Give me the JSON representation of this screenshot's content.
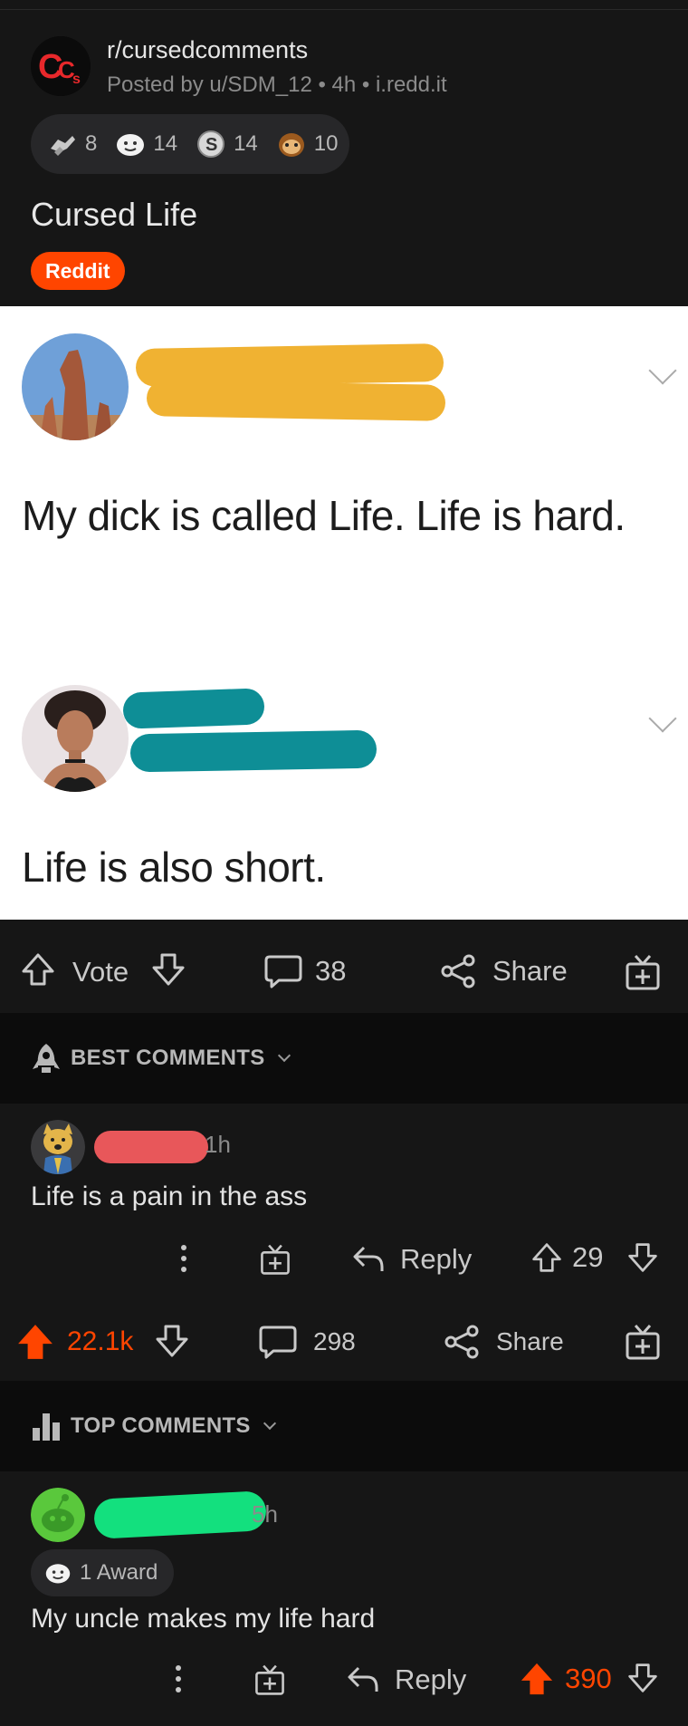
{
  "post": {
    "subreddit": "r/cursedcomments",
    "meta": "Posted by u/SDM_12 • 4h • i.redd.it",
    "awards": [
      {
        "icon": "handshake-award-icon",
        "count": "8"
      },
      {
        "icon": "wholesome-award-icon",
        "count": "14"
      },
      {
        "icon": "silver-award-icon",
        "count": "14"
      },
      {
        "icon": "sloth-award-icon",
        "count": "10"
      }
    ],
    "title": "Cursed Life",
    "flair": "Reddit",
    "image": {
      "tweet1_text": "My dick is called Life. Life is hard.",
      "tweet2_text": "Life is also short."
    },
    "actions": {
      "vote_label": "Vote",
      "comments_count": "38",
      "share_label": "Share"
    }
  },
  "best_comments": {
    "header": "BEST COMMENTS",
    "comment": {
      "time": "1h",
      "text": "Life is a pain in the ass",
      "reply_label": "Reply",
      "score": "29"
    }
  },
  "stats_bar": {
    "score": "22.1k",
    "comments_count": "298",
    "share_label": "Share"
  },
  "top_comments": {
    "header": "TOP COMMENTS",
    "comment": {
      "time": "5h",
      "award_label": "1 Award",
      "text": "My uncle makes my life hard",
      "reply_label": "Reply",
      "score": "390"
    }
  },
  "colors": {
    "background": "#161616",
    "accent": "#ff4500",
    "yellow_scribble": "#f0b232",
    "teal_scribble": "#0e8e96",
    "red_scribble": "#e8575a",
    "green_scribble": "#13e07e"
  }
}
